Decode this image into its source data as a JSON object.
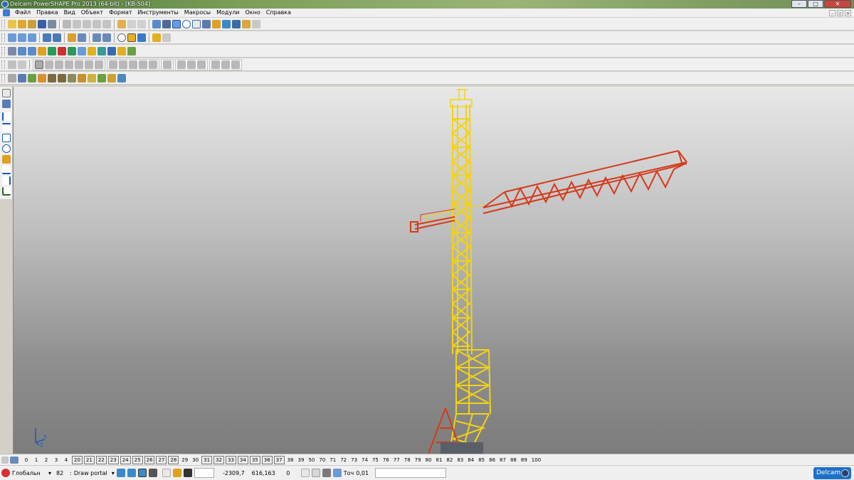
{
  "window": {
    "title": "Delcam PowerSHAPE Pro 2013 (64-bit) - [KB-504]",
    "minimize": "–",
    "maximize": "□",
    "close": "✕"
  },
  "menu": {
    "items": [
      "Файл",
      "Правка",
      "Вид",
      "Объект",
      "Формат",
      "Инструменты",
      "Макросы",
      "Модули",
      "Окно",
      "Справка"
    ],
    "mdi_minimize": "–",
    "mdi_restore": "▫",
    "mdi_close": "×"
  },
  "levels": {
    "items": [
      "0",
      "1",
      "2",
      "3",
      "4",
      "20",
      "21",
      "22",
      "23",
      "24",
      "25",
      "26",
      "27",
      "28",
      "29",
      "30",
      "31",
      "32",
      "33",
      "34",
      "35",
      "36",
      "37",
      "38",
      "39",
      "50",
      "70",
      "71",
      "72",
      "73",
      "74",
      "75",
      "76",
      "77",
      "78",
      "79",
      "80",
      "81",
      "82",
      "83",
      "84",
      "85",
      "86",
      "87",
      "88",
      "89",
      "100"
    ],
    "on": [
      "20",
      "21",
      "22",
      "23",
      "24",
      "25",
      "26",
      "27",
      "28",
      "31",
      "32",
      "33",
      "34",
      "35",
      "36",
      "37"
    ]
  },
  "status": {
    "workplane": "Глобальн",
    "level_number": "82",
    "level_name": "Draw portal",
    "coord_x": "-2309,7",
    "coord_y": "616,163",
    "coord_z": "0",
    "tolerance_label": "Точ",
    "tolerance_value": "0,01",
    "brand": "Delcam"
  },
  "axes": {
    "x": "X",
    "z": "Z"
  },
  "colors": {
    "crane_tower": "#f2d314",
    "crane_jib": "#d43a1a",
    "brand": "#1e6fc6"
  }
}
